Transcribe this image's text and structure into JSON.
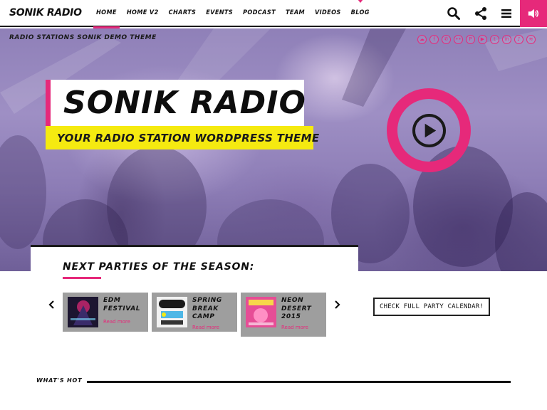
{
  "header": {
    "logo": "SONIK RADIO",
    "nav": [
      "HOME",
      "HOME V2",
      "CHARTS",
      "EVENTS",
      "PODCAST",
      "TEAM",
      "VIDEOS",
      "BLOG"
    ],
    "icons": [
      "search-icon",
      "share-icon",
      "menu-icon",
      "volume-icon"
    ]
  },
  "hero": {
    "subtitle": "RADIO STATIONS SONIK DEMO THEME",
    "social_icons": [
      "soundcloud-icon",
      "facebook-icon",
      "whatsapp-icon",
      "flickr-icon",
      "pinterest-icon",
      "youtube-icon",
      "twitter-icon",
      "linkedin-icon",
      "lastfm-icon",
      "spotify-icon"
    ],
    "title": "SONIK RADIO",
    "tagline": "YOUR RADIO STATION WORDPRESS THEME"
  },
  "parties": {
    "heading": "NEXT PARTIES OF THE SEASON:",
    "cards": [
      {
        "name": "EDM FESTIVAL",
        "more": "Read more"
      },
      {
        "name": "SPRING BREAK CAMP",
        "more": "Read more"
      },
      {
        "name": "NEON DESERT 2015",
        "more": "Read more"
      }
    ],
    "calendar_button": "CHECK FULL PARTY CALENDAR!"
  },
  "whats_hot": {
    "label": "WHAT'S HOT"
  },
  "colors": {
    "accent": "#e6297a",
    "yellow": "#f5ea10",
    "dark": "#1a1a1a"
  }
}
